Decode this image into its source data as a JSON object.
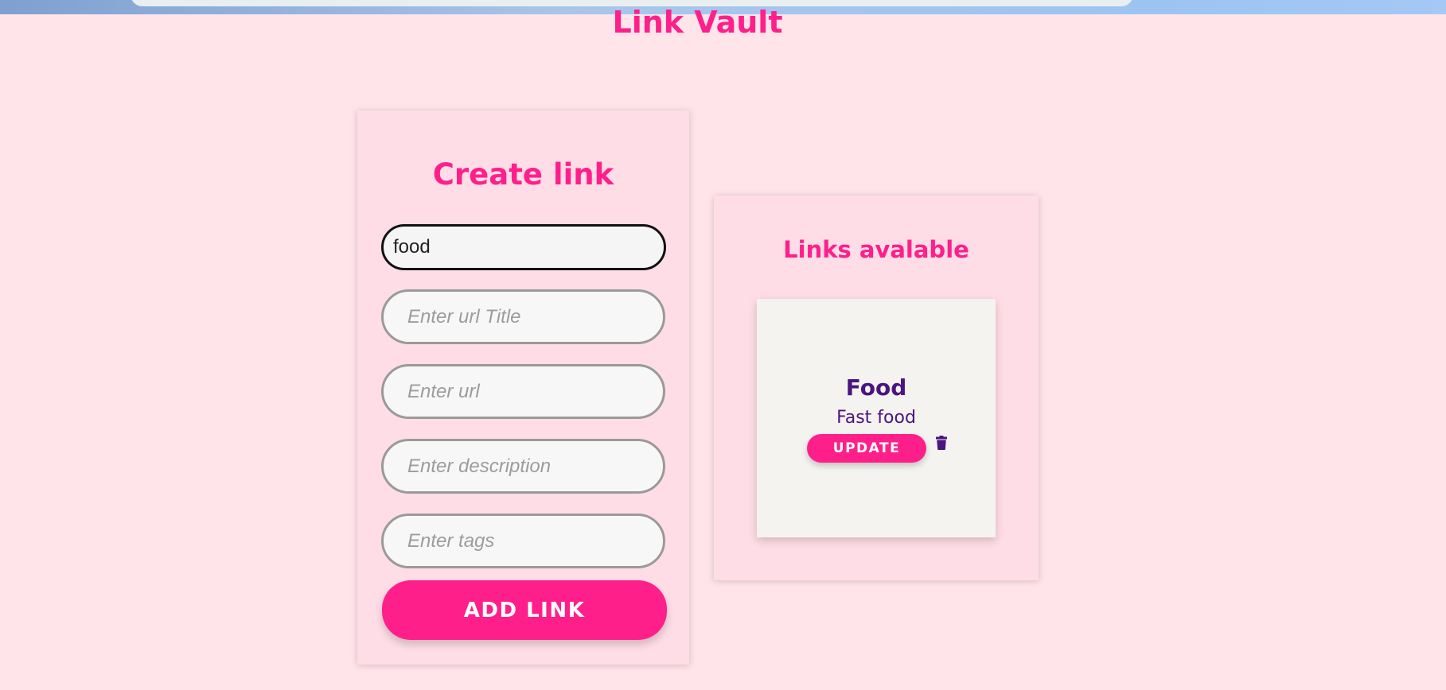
{
  "app": {
    "title": "Link Vault"
  },
  "create_form": {
    "heading": "Create link",
    "fields": [
      {
        "name": "link-name-field",
        "value": "food",
        "placeholder": ""
      },
      {
        "name": "url-title-field",
        "value": "",
        "placeholder": "Enter url Title"
      },
      {
        "name": "url-field",
        "value": "",
        "placeholder": "Enter url"
      },
      {
        "name": "description-field",
        "value": "",
        "placeholder": "Enter description"
      },
      {
        "name": "tags-field",
        "value": "",
        "placeholder": "Enter tags"
      }
    ],
    "submit_label": "ADD LINK"
  },
  "links_panel": {
    "heading": "Links avalable",
    "items": [
      {
        "title": "Food",
        "description": "Fast food",
        "update_label": "UPDATE",
        "delete_icon": "trash-icon"
      }
    ]
  },
  "colors": {
    "background": "#ffe4ea",
    "accent": "#ff1f8a",
    "card_text": "#4a1580"
  }
}
